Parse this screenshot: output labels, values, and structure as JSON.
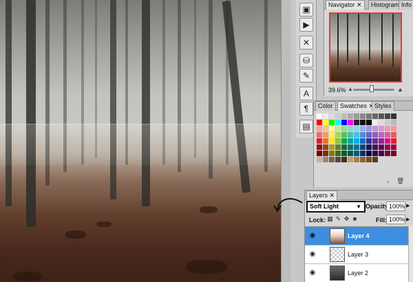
{
  "navigator": {
    "tabs": [
      "Navigator",
      "Histogram",
      "Info"
    ],
    "zoom": "39.6%"
  },
  "swatches": {
    "tabs": [
      "Color",
      "Swatches",
      "Styles"
    ],
    "colors": [
      "#ffffff",
      "#eeeeee",
      "#dddddd",
      "#cccccc",
      "#bbbbbb",
      "#aaaaaa",
      "#999999",
      "#888888",
      "#777777",
      "#666666",
      "#555555",
      "#444444",
      "#333333",
      "#ff0000",
      "#ffff00",
      "#00ff00",
      "#00ffff",
      "#0000ff",
      "#ff00ff",
      "#222222",
      "#111111",
      "#000000",
      "#eeeeee",
      "#dddddd",
      "#cccccc",
      "#bbbbbb",
      "#f4a3a3",
      "#f9c28b",
      "#fff59a",
      "#c7e89a",
      "#9ad79b",
      "#8fd3c9",
      "#8fd1ee",
      "#8fb5e5",
      "#9d9ad6",
      "#b69ad6",
      "#d69ad1",
      "#e89ab9",
      "#f09a9a",
      "#ef6b6b",
      "#f39c5a",
      "#fff15e",
      "#a6d75f",
      "#5dbd5e",
      "#4ebfae",
      "#4db9e5",
      "#4c8ed6",
      "#6860c4",
      "#8d5fc4",
      "#c45ebd",
      "#e05d93",
      "#e85d5d",
      "#e31e24",
      "#f37021",
      "#ffed00",
      "#8dc63f",
      "#00a651",
      "#00a99d",
      "#00aeef",
      "#0072bc",
      "#2e3192",
      "#662d91",
      "#92278f",
      "#ec008c",
      "#ed1c24",
      "#9e0b0f",
      "#a0410d",
      "#aba000",
      "#598527",
      "#007236",
      "#00746b",
      "#0076a3",
      "#004a80",
      "#1b1464",
      "#440e62",
      "#630460",
      "#9e005d",
      "#9e0039",
      "#790000",
      "#7b2e00",
      "#827b00",
      "#406618",
      "#005e20",
      "#005952",
      "#005b7f",
      "#003663",
      "#0d004c",
      "#32004b",
      "#4b0049",
      "#7b0046",
      "#7a0026",
      "#c7b299",
      "#998675",
      "#736357",
      "#534741",
      "#37302d",
      "#c69c6d",
      "#a67c52",
      "#8c6239",
      "#754c24",
      "#603913"
    ],
    "new_swatch_icon": "new-swatch-icon",
    "trash_icon": "trash-icon"
  },
  "layers": {
    "tab": "Layers",
    "blend_mode": "Soft Light",
    "opacity_label": "Opacity:",
    "opacity_value": "100%",
    "lock_label": "Lock:",
    "fill_label": "Fill:",
    "fill_value": "100%",
    "rows": [
      {
        "name": "Layer 4",
        "selected": true
      },
      {
        "name": "Layer 3",
        "selected": false
      },
      {
        "name": "Layer 2",
        "selected": false
      }
    ]
  }
}
